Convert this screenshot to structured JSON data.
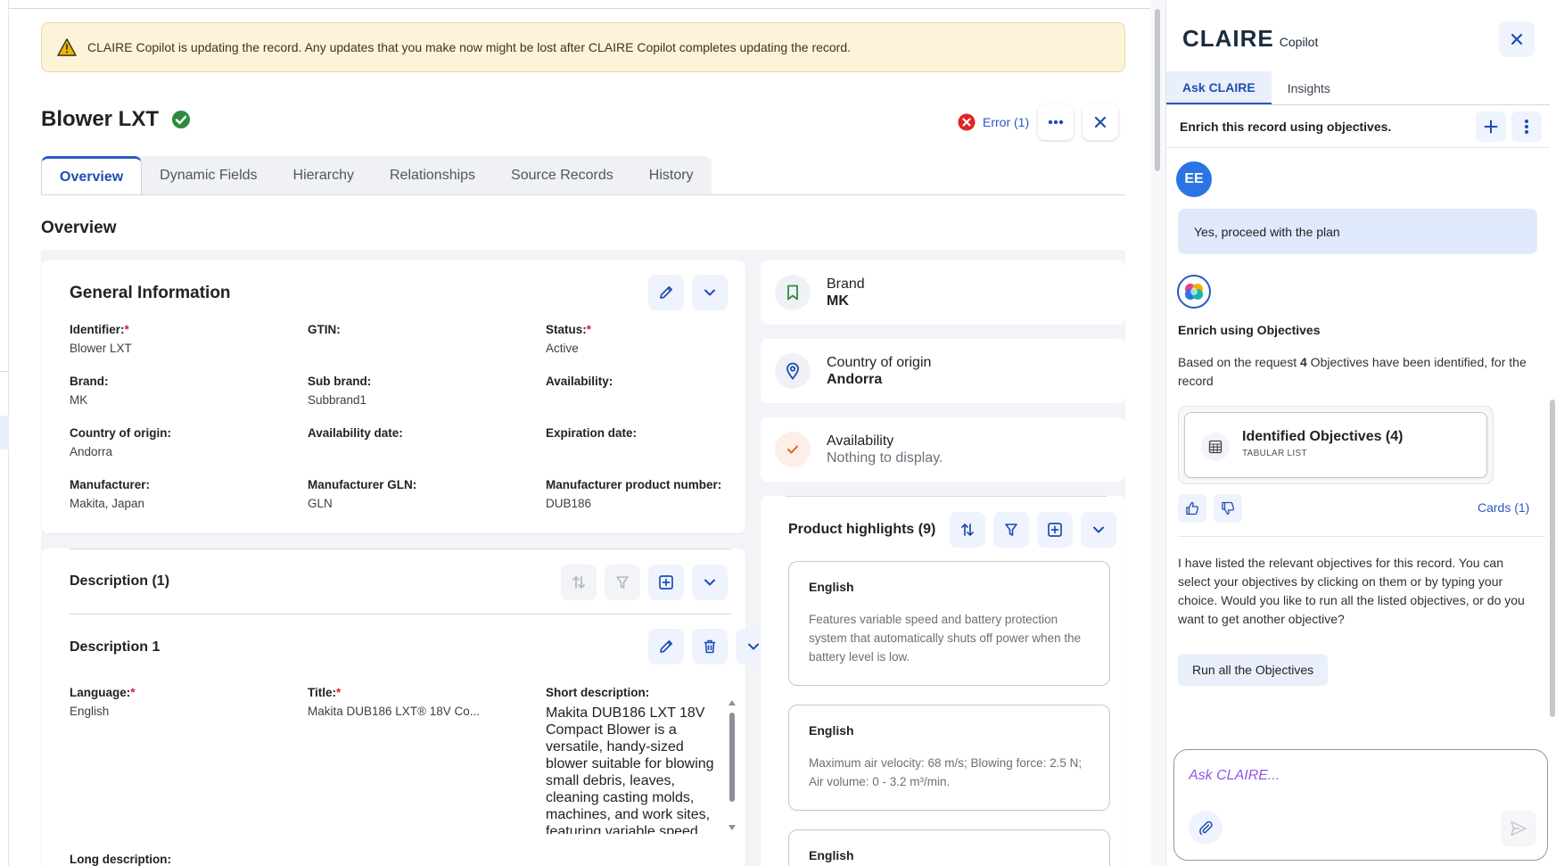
{
  "banner": {
    "text": "CLAIRE Copilot is updating the record. Any updates that you make now might be lost after CLAIRE Copilot completes updating the record."
  },
  "record": {
    "title": "Blower LXT",
    "error_label": "Error (1)"
  },
  "tabs": [
    {
      "label": "Overview",
      "active": true
    },
    {
      "label": "Dynamic Fields"
    },
    {
      "label": "Hierarchy"
    },
    {
      "label": "Relationships"
    },
    {
      "label": "Source Records"
    },
    {
      "label": "History"
    }
  ],
  "section_title": "Overview",
  "general": {
    "title": "General Information",
    "fields": [
      {
        "label": "Identifier:",
        "required": true,
        "value": "Blower LXT"
      },
      {
        "label": "GTIN:",
        "required": false,
        "value": ""
      },
      {
        "label": "Status:",
        "required": true,
        "value": "Active"
      },
      {
        "label": "Brand:",
        "required": false,
        "value": "MK"
      },
      {
        "label": "Sub brand:",
        "required": false,
        "value": "Subbrand1"
      },
      {
        "label": "Availability:",
        "required": false,
        "value": ""
      },
      {
        "label": "Country of origin:",
        "required": false,
        "value": "Andorra"
      },
      {
        "label": "Availability date:",
        "required": false,
        "value": ""
      },
      {
        "label": "Expiration date:",
        "required": false,
        "value": ""
      },
      {
        "label": "Manufacturer:",
        "required": false,
        "value": "Makita, Japan"
      },
      {
        "label": "Manufacturer GLN:",
        "required": false,
        "value": "GLN"
      },
      {
        "label": "Manufacturer product number:",
        "required": false,
        "value": "DUB186"
      }
    ]
  },
  "description": {
    "title": "Description (1)",
    "item_title": "Description 1",
    "language_label": "Language:",
    "language_value": "English",
    "title_label": "Title:",
    "title_value": "Makita DUB186 LXT® 18V Co...",
    "short_label": "Short description:",
    "short_value": "Makita DUB186 LXT 18V Compact Blower is a versatile, handy-sized blower suitable for blowing small debris, leaves, cleaning casting molds, machines, and work sites, featuring variable speed",
    "long_label": "Long description:"
  },
  "side_cards": [
    {
      "title": "Brand",
      "value": "MK",
      "icon": "bookmark-icon"
    },
    {
      "title": "Country of origin",
      "value": "Andorra",
      "icon": "location-pin-icon"
    },
    {
      "title": "Availability",
      "value": "Nothing to display.",
      "icon": "check-icon"
    }
  ],
  "highlights": {
    "title": "Product highlights (9)",
    "items": [
      {
        "lang": "English",
        "text": "Features variable speed and battery protection system that automatically shuts off power when the battery level is low."
      },
      {
        "lang": "English",
        "text": "Maximum air velocity: 68 m/s; Blowing force: 2.5 N; Air volume: 0 - 3.2 m³/min."
      },
      {
        "lang": "English",
        "text": ""
      }
    ]
  },
  "copilot": {
    "brand": "CLAIRE",
    "brand_sub": "Copilot",
    "tabs": [
      {
        "label": "Ask CLAIRE",
        "active": true
      },
      {
        "label": "Insights"
      }
    ],
    "enrich_label": "Enrich this record using objectives.",
    "user_initials": "EE",
    "user_message": "Yes, proceed with the plan",
    "bot_title": "Enrich using Objectives",
    "bot_text_pre": "Based on the request ",
    "bot_text_count": "4",
    "bot_text_post": " Objectives have been identified, for the record",
    "objectives_title": "Identified Objectives (4)",
    "objectives_sub": "TABULAR LIST",
    "cards_link": "Cards (1)",
    "bot_text2": "I have listed the relevant objectives for this record. You can select your objectives by clicking on them or by typing your choice. Would you like to run all the listed objectives, or do you want to get another objective?",
    "run_all_label": "Run all the Objectives",
    "input_placeholder": "Ask CLAIRE..."
  },
  "colors": {
    "accent": "#2a58c4",
    "banner_bg": "#fdf3d8",
    "success": "#2e8b3e",
    "error": "#e02424"
  }
}
